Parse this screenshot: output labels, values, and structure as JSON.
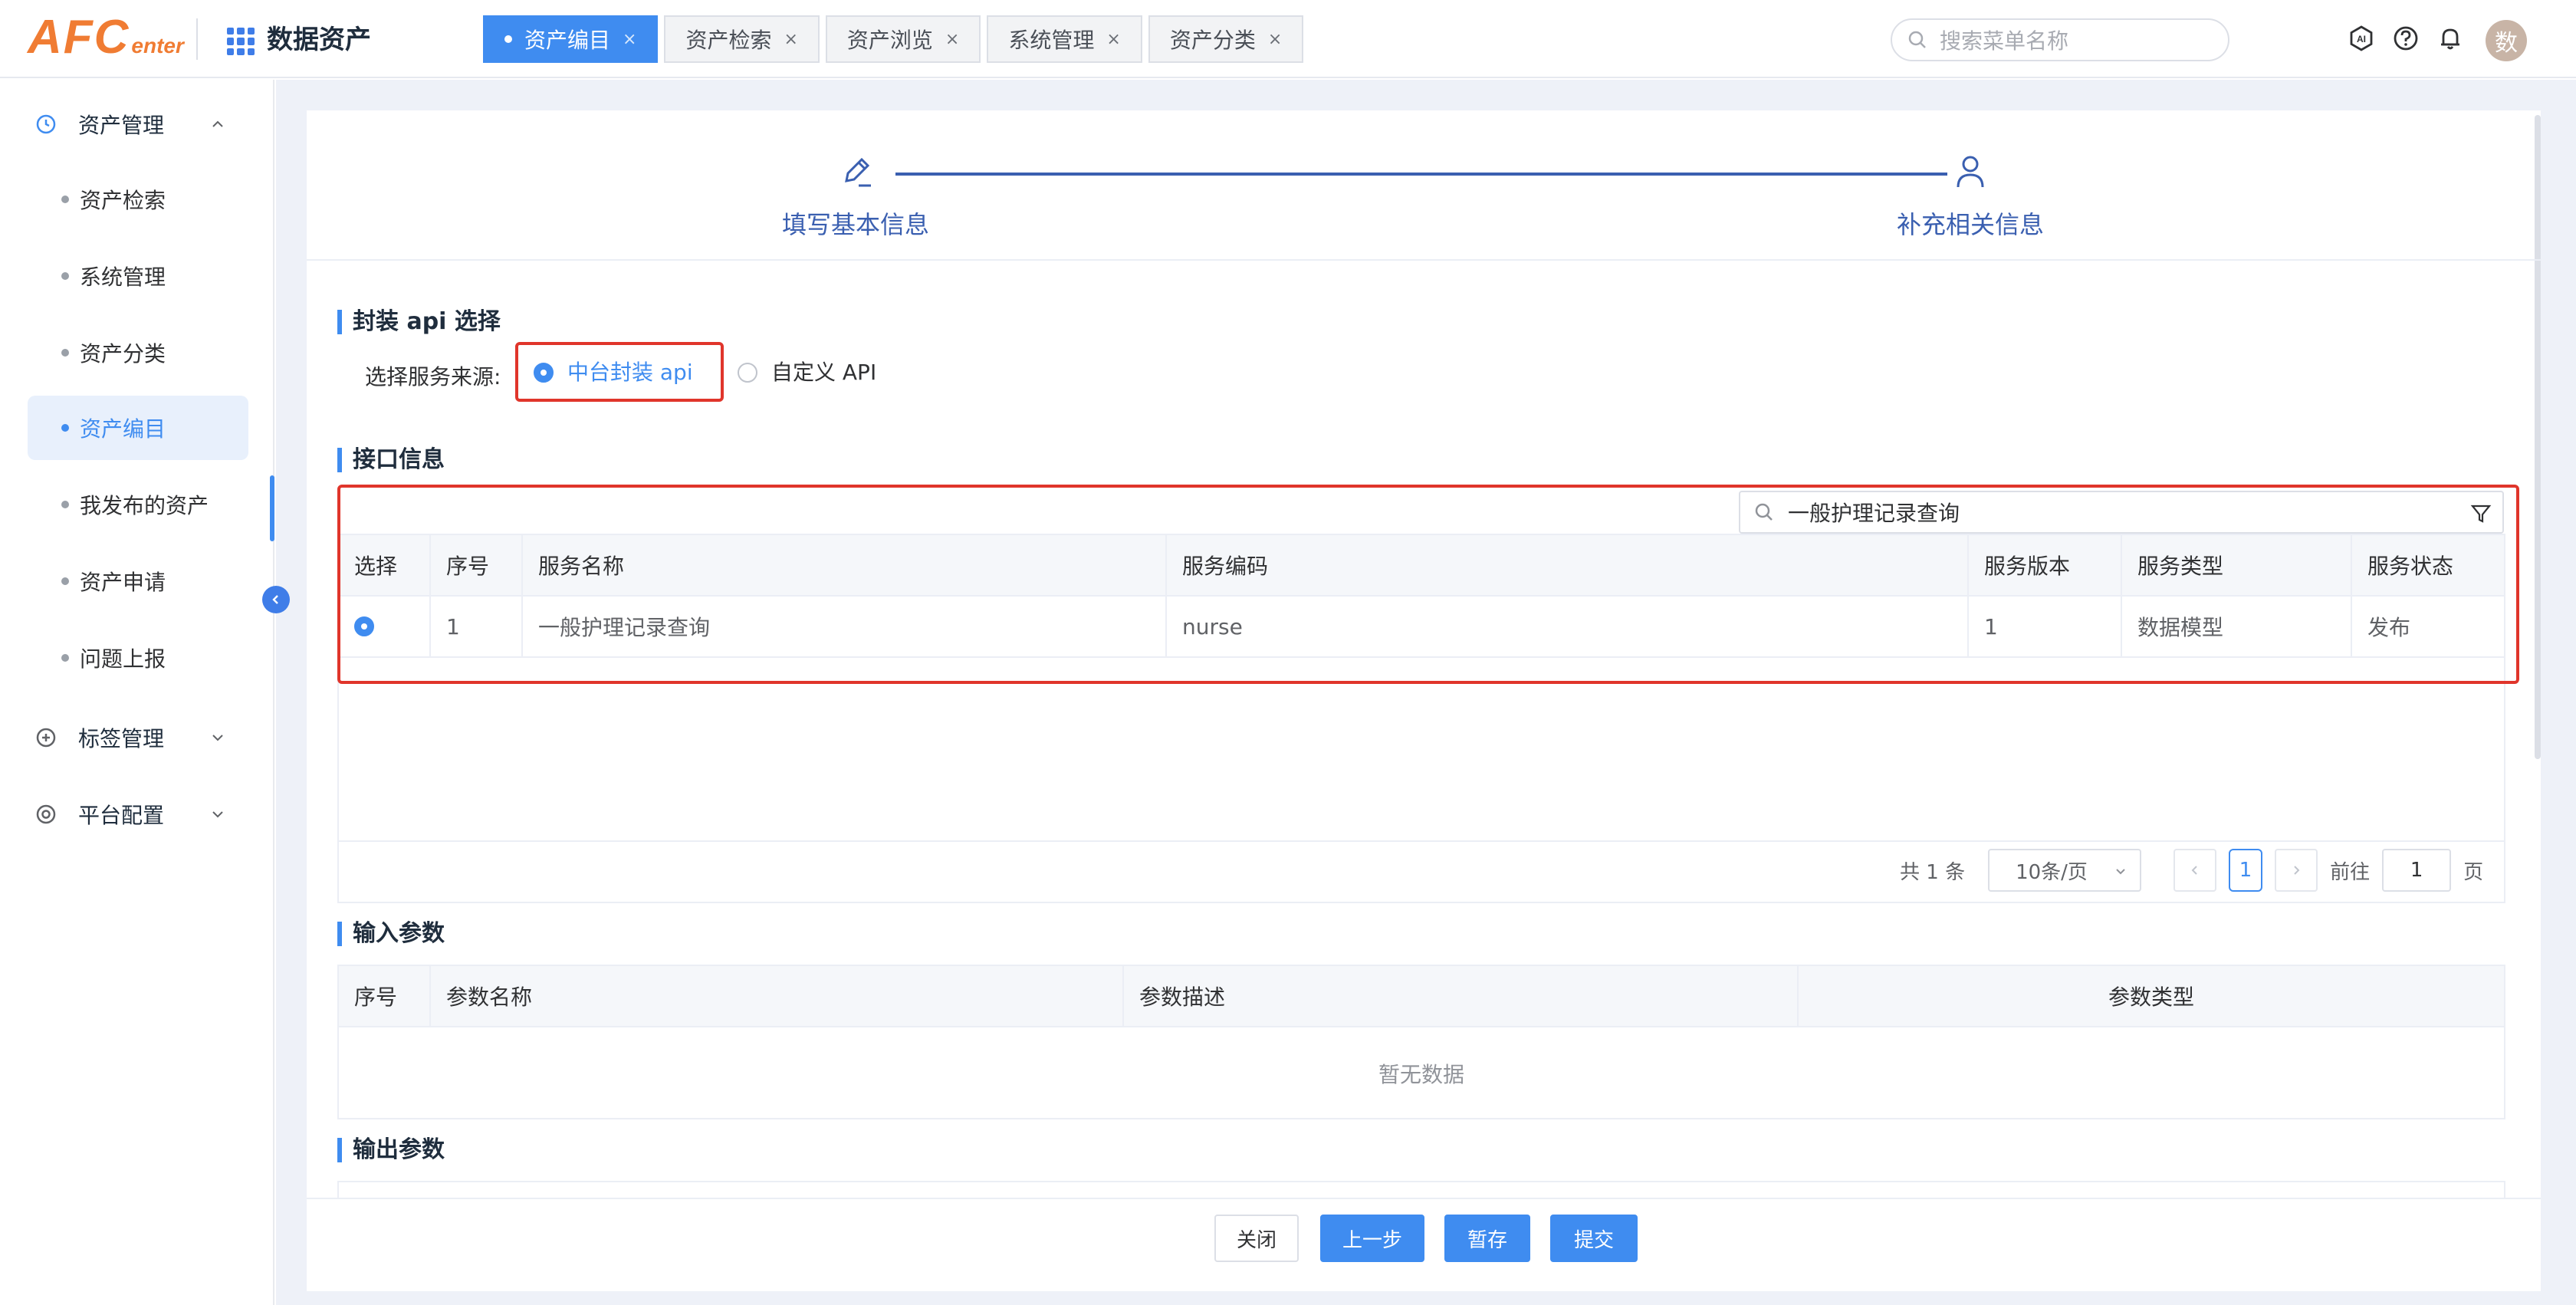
{
  "header": {
    "logo": {
      "main": "AFC",
      "sub": "enter"
    },
    "app_title": "数据资产",
    "tabs": [
      {
        "label": "资产编目",
        "active": true
      },
      {
        "label": "资产检索",
        "active": false
      },
      {
        "label": "资产浏览",
        "active": false
      },
      {
        "label": "系统管理",
        "active": false
      },
      {
        "label": "资产分类",
        "active": false
      }
    ],
    "tab_close": "×",
    "search_placeholder": "搜索菜单名称",
    "icons": [
      "ai-icon",
      "help-icon",
      "bell-icon"
    ],
    "avatar_text": "数"
  },
  "sidebar": {
    "groups": [
      {
        "label": "资产管理",
        "icon": "clock-icon",
        "expanded": true
      },
      {
        "label": "标签管理",
        "icon": "plus-circle-icon",
        "expanded": false
      },
      {
        "label": "平台配置",
        "icon": "settings-icon",
        "expanded": false
      }
    ],
    "items": [
      {
        "label": "资产检索",
        "active": false
      },
      {
        "label": "系统管理",
        "active": false
      },
      {
        "label": "资产分类",
        "active": false
      },
      {
        "label": "资产编目",
        "active": true
      },
      {
        "label": "我发布的资产",
        "active": false
      },
      {
        "label": "资产申请",
        "active": false
      },
      {
        "label": "问题上报",
        "active": false
      }
    ]
  },
  "steps": [
    {
      "label": "填写基本信息",
      "icon": "pen-icon"
    },
    {
      "label": "补充相关信息",
      "icon": "user-icon"
    }
  ],
  "api_section": {
    "title": "封装 api 选择",
    "source_label": "选择服务来源:",
    "options": [
      {
        "label": "中台封装 api",
        "checked": true
      },
      {
        "label": "自定义 API",
        "checked": false
      }
    ]
  },
  "interface_section": {
    "title": "接口信息",
    "search_value": "一般护理记录查询",
    "columns": [
      "选择",
      "序号",
      "服务名称",
      "服务编码",
      "服务版本",
      "服务类型",
      "服务状态"
    ],
    "rows": [
      {
        "selected": true,
        "index": "1",
        "name": "一般护理记录查询",
        "code": "nurse",
        "version": "1",
        "type": "数据模型",
        "status": "发布"
      }
    ],
    "pagination": {
      "total": "共 1 条",
      "page_size": "10条/页",
      "current": "1",
      "goto_label": "前往",
      "goto_value": "1",
      "page_unit": "页"
    }
  },
  "input_section": {
    "title": "输入参数",
    "columns": [
      "序号",
      "参数名称",
      "参数描述",
      "参数类型"
    ],
    "empty_text": "暂无数据"
  },
  "output_section": {
    "title": "输出参数"
  },
  "footer": {
    "close": "关闭",
    "prev": "上一步",
    "save": "暂存",
    "submit": "提交"
  },
  "colors": {
    "primary": "#3f8cf0",
    "highlight": "#e0352b",
    "logo": "#f07c33"
  }
}
